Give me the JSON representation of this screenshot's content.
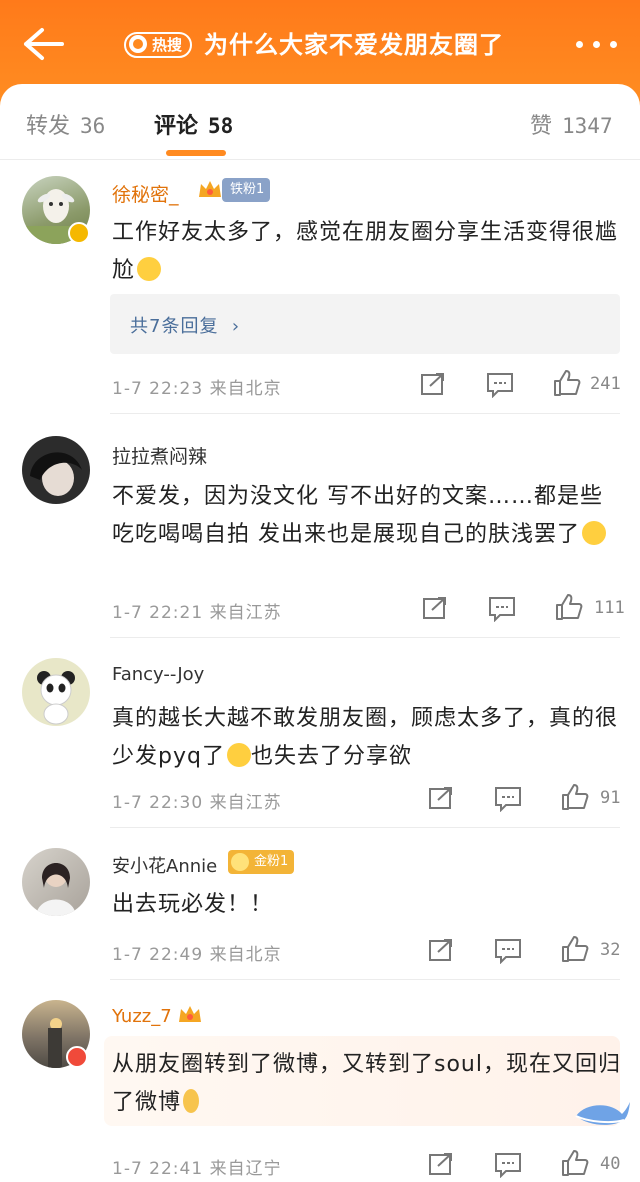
{
  "header": {
    "hot_label": "热搜",
    "title": "为什么大家不爱发朋友圈了"
  },
  "tabs": [
    {
      "label": "转发",
      "count": "36"
    },
    {
      "label": "评论",
      "count": "58"
    },
    {
      "label": "赞",
      "count": "1347"
    }
  ],
  "comments": [
    {
      "user": "徐秘密_",
      "fan_badge": "铁粉1",
      "text": "工作好友太多了，感觉在朋友圈分享生活变得很尴尬",
      "replies": "共7条回复",
      "time": "1-7  22:23",
      "location": "来自北京",
      "likes": "241"
    },
    {
      "user": "拉拉煮闷辣",
      "text": "不爱发，因为没文化 写不出好的文案……都是些吃吃喝喝自拍 发出来也是展现自己的肤浅罢了",
      "time": "1-7  22:21",
      "location": "来自江苏",
      "likes": "111"
    },
    {
      "user": "Fancy--Joy",
      "text_a": "真的越长大越不敢发朋友圈，顾虑太多了，真的很少发pyq了",
      "text_b": "也失去了分享欲",
      "time": "1-7  22:30",
      "location": "来自江苏",
      "likes": "91"
    },
    {
      "user": "安小花Annie",
      "fan_badge": "金粉1",
      "text": "出去玩必发！！",
      "time": "1-7  22:49",
      "location": "来自北京",
      "likes": "32"
    },
    {
      "user": "Yuzz_7",
      "text": "从朋友圈转到了微博，又转到了soul，现在又回归了微博",
      "time": "1-7  22:41",
      "location": "来自辽宁",
      "likes": "40"
    }
  ],
  "colors": {
    "header": "#ff7a1a",
    "accent": "#ff8a20",
    "link": "#4a6e9a",
    "vip_name": "#e1730b"
  }
}
